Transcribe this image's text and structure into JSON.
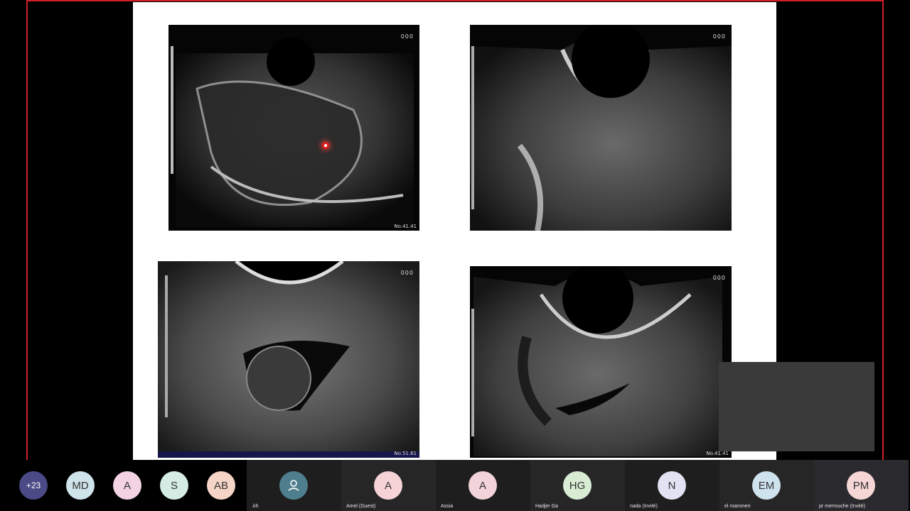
{
  "slide": {
    "images": [
      {
        "corner_label": "No.41.41",
        "dots": "000"
      },
      {
        "corner_label": "",
        "dots": "000"
      },
      {
        "corner_label": "No.51.61",
        "dots": "000"
      },
      {
        "corner_label": "No.41.41",
        "dots": "000"
      }
    ]
  },
  "participants_bar": {
    "overflow_count": "+23",
    "lead_avatars": [
      {
        "initials": "MD",
        "color": "#cfe3ea"
      },
      {
        "initials": "A",
        "color": "#f3d3e3"
      },
      {
        "initials": "S",
        "color": "#d5ece5"
      },
      {
        "initials": "AB",
        "color": "#f6d5c6"
      }
    ],
    "tiles": [
      {
        "initials": "",
        "name": ".kh",
        "color": "#4f7f8e",
        "icon": "person-icon"
      },
      {
        "initials": "A",
        "name": "Amel (Guest)",
        "color": "#f6d3d6"
      },
      {
        "initials": "A",
        "name": "Assia",
        "color": "#f3d3da"
      },
      {
        "initials": "HG",
        "name": "Hadjer Ga",
        "color": "#d8ecd4"
      },
      {
        "initials": "N",
        "name": "nada (Invité)",
        "color": "#e1e2f2"
      },
      {
        "initials": "EM",
        "name": "el mammeri",
        "color": "#cfe3ef"
      },
      {
        "initials": "PM",
        "name": "pr merrouche (Invité)",
        "color": "#f7d6d6"
      }
    ]
  },
  "colors": {
    "share_border": "#d0202a",
    "overflow_badge": "#4a4a86"
  }
}
